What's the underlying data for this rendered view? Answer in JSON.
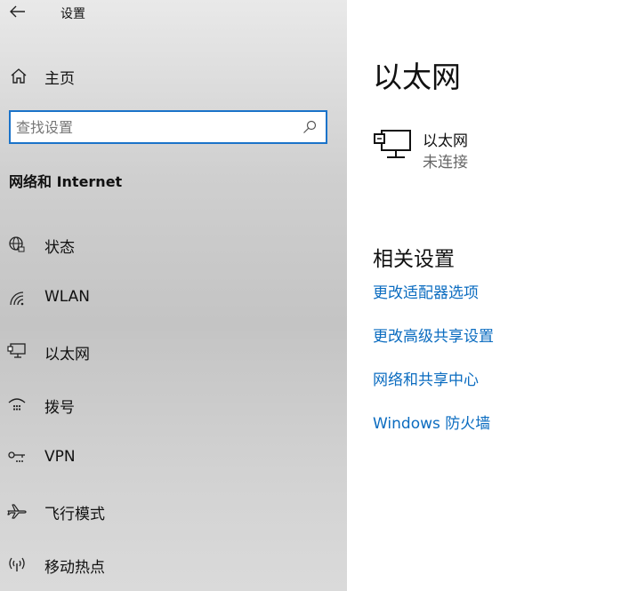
{
  "window": {
    "title": "设置"
  },
  "sidebar": {
    "home_label": "主页",
    "search": {
      "placeholder": "查找设置",
      "value": ""
    },
    "section_title": "网络和 Internet",
    "items": [
      {
        "label": "状态",
        "icon": "globe-icon"
      },
      {
        "label": "WLAN",
        "icon": "wifi-icon"
      },
      {
        "label": "以太网",
        "icon": "ethernet-icon"
      },
      {
        "label": "拨号",
        "icon": "dialup-icon"
      },
      {
        "label": "VPN",
        "icon": "vpn-icon"
      },
      {
        "label": "飞行模式",
        "icon": "airplane-icon"
      },
      {
        "label": "移动热点",
        "icon": "hotspot-icon"
      }
    ]
  },
  "main": {
    "title": "以太网",
    "ethernet": {
      "name": "以太网",
      "status": "未连接"
    },
    "related_title": "相关设置",
    "links": [
      "更改适配器选项",
      "更改高级共享设置",
      "网络和共享中心",
      "Windows 防火墙"
    ]
  },
  "colors": {
    "accent": "#0b6cc0",
    "search_border": "#1a73c9"
  }
}
